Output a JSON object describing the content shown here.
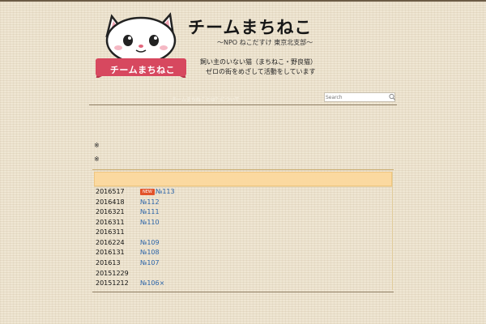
{
  "header": {
    "logo_band_text": "チームまちねこ",
    "title": "チームまちねこ",
    "subtitle": "〜NPO ねこだすけ 東京北支部〜",
    "tagline_1": "飼い主のいない猫（まちねこ・野良猫）",
    "tagline_2": "ゼロの街をめざして活動をしています"
  },
  "nav": {
    "link_label": "チームまちねことは？について"
  },
  "search": {
    "placeholder": "Search"
  },
  "content": {
    "mark_1": "※",
    "mark_2": "※"
  },
  "news": {
    "rows": [
      {
        "date": "2016517",
        "badge": "NEW",
        "link": "№113"
      },
      {
        "date": "2016418",
        "badge": "",
        "link": "№112"
      },
      {
        "date": "2016321",
        "badge": "",
        "link": "№111"
      },
      {
        "date": "2016311",
        "badge": "",
        "link": "№110"
      },
      {
        "date": "2016311",
        "badge": "",
        "link": ""
      },
      {
        "date": "2016224",
        "badge": "",
        "link": "№109"
      },
      {
        "date": "2016131",
        "badge": "",
        "link": "№108"
      },
      {
        "date": "201613",
        "badge": "",
        "link": "№107"
      },
      {
        "date": "20151229",
        "badge": "",
        "link": ""
      },
      {
        "date": "20151212",
        "badge": "",
        "link": "№106×"
      }
    ]
  },
  "colors": {
    "accent": "#d7485f",
    "link": "#2a63a8",
    "news_header": "#fbd9a0",
    "badge": "#e2532a"
  }
}
